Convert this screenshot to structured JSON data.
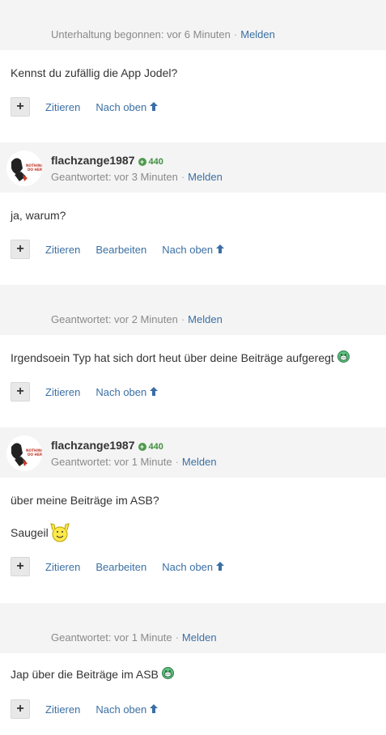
{
  "posts": [
    {
      "author": "",
      "meta_time": "Unterhaltung begonnen: vor 6 Minuten",
      "report": "Melden",
      "body": [
        "Kennst du zufällig die App Jodel?"
      ],
      "actions": [
        "Zitieren",
        "Nach oben"
      ]
    },
    {
      "author": "flachzange1987",
      "reputation": "440",
      "avatar_text": "NOTHING TO DO HERE",
      "meta_time": "Geantwortet: vor 3 Minuten",
      "report": "Melden",
      "body": [
        "ja, warum?"
      ],
      "actions": [
        "Zitieren",
        "Bearbeiten",
        "Nach oben"
      ]
    },
    {
      "author": "",
      "meta_time": "Geantwortet: vor 2 Minuten",
      "report": "Melden",
      "body": [
        "Irgendsoein Typ hat sich dort heut über deine Beiträge aufgeregt"
      ],
      "actions": [
        "Zitieren",
        "Nach oben"
      ]
    },
    {
      "author": "flachzange1987",
      "reputation": "440",
      "avatar_text": "NOTHING TO DO HERE",
      "meta_time": "Geantwortet: vor 1 Minute",
      "report": "Melden",
      "body": [
        "über meine Beiträge im ASB?",
        "Saugeil"
      ],
      "actions": [
        "Zitieren",
        "Bearbeiten",
        "Nach oben"
      ]
    },
    {
      "author": "",
      "meta_time": "Geantwortet: vor 1 Minute",
      "report": "Melden",
      "body": [
        "Jap über die Beiträge im ASB"
      ],
      "actions": [
        "Zitieren",
        "Nach oben"
      ]
    }
  ],
  "plus_symbol": "+",
  "colors": {
    "link": "#3b6fa3",
    "header_bg": "#f4f4f4",
    "rep": "#3f8f3f"
  }
}
